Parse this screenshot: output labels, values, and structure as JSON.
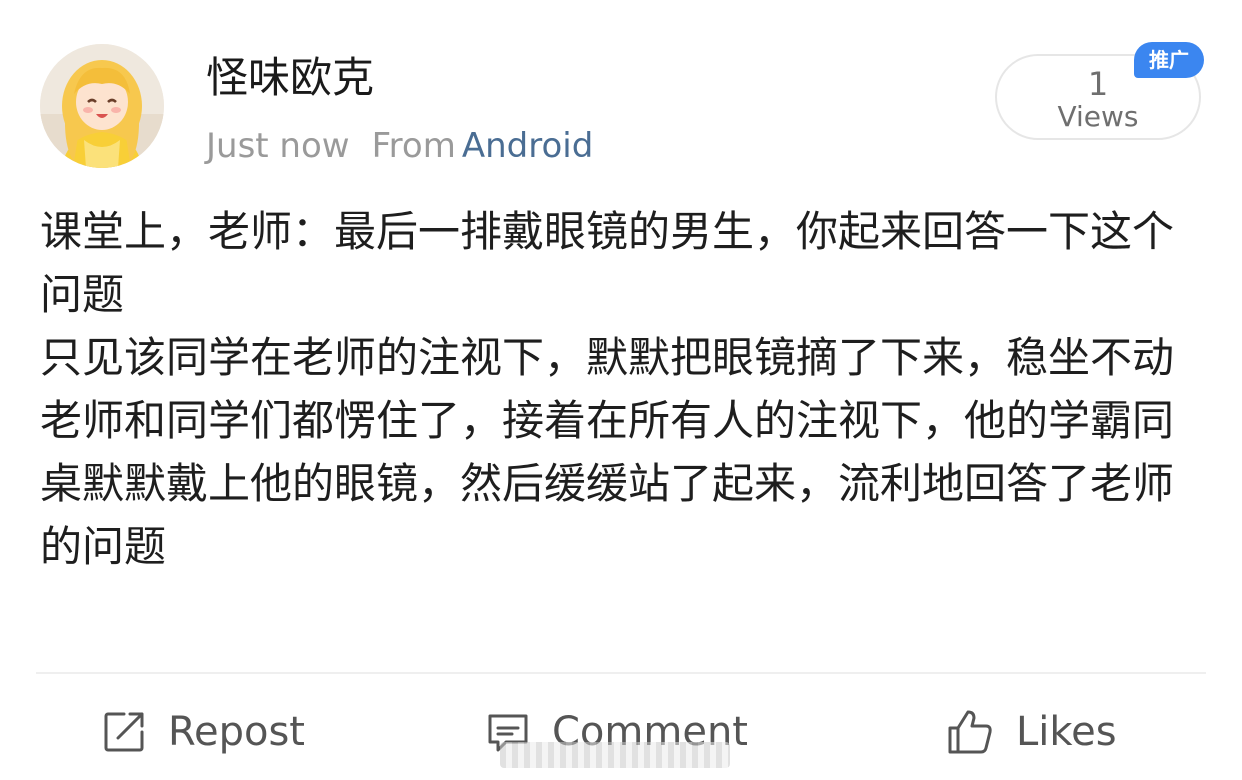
{
  "author": {
    "name": "怪味欧克",
    "avatar_icon": "cartoon-girl-avatar"
  },
  "meta": {
    "time": "Just now",
    "from_label": "From",
    "source": "Android"
  },
  "views": {
    "count": "1",
    "label": "Views",
    "badge": "推广"
  },
  "post": {
    "paragraphs": [
      "课堂上，老师：最后一排戴眼镜的男生，你起来回答一下这个问题",
      "只见该同学在老师的注视下，默默把眼镜摘了下来，稳坐不动",
      "老师和同学们都愣住了，接着在所有人的注视下，他的学霸同桌默默戴上他的眼镜，然后缓缓站了起来，流利地回答了老师的问题"
    ]
  },
  "actions": {
    "repost": "Repost",
    "comment": "Comment",
    "likes": "Likes"
  },
  "colors": {
    "link": "#4a6d93",
    "badge": "#3b86f0",
    "muted": "#9a9a9a"
  }
}
